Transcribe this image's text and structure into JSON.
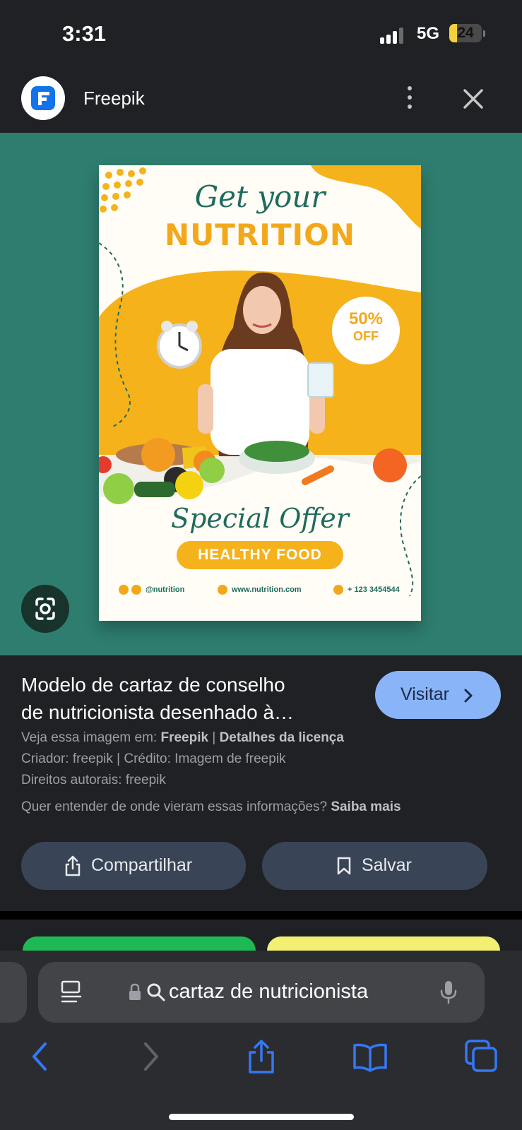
{
  "status_bar": {
    "time": "3:31",
    "network": "5G",
    "battery": "24",
    "battery_level": 0.24
  },
  "site": {
    "name": "Freepik"
  },
  "poster": {
    "title_line1": "Get your",
    "title_line2": "NUTRITION",
    "discount_pct": "50%",
    "discount_off": "OFF",
    "special": "Special Offer",
    "pill": "HEALTHY FOOD",
    "footer_handle": "@nutrition",
    "footer_site": "www.nutrition.com",
    "footer_phone": "+ 123 3454544"
  },
  "result": {
    "title_line1": "Modelo de cartaz de conselho",
    "title_line2": "de nutricionista desenhado à…",
    "visit_label": "Visitar",
    "view_prefix": "Veja essa imagem em:",
    "view_source": "Freepik",
    "separator": "|",
    "license_link": "Detalhes da licença",
    "creator": "Criador: freepik | Crédito: Imagem de freepik",
    "copyright": "Direitos autorais: freepik",
    "question": "Quer entender de onde vieram essas informações?",
    "learn_more": "Saiba mais",
    "share_label": "Compartilhar",
    "save_label": "Salvar"
  },
  "browser": {
    "url_text": "cartaz de nutricionista"
  },
  "colors": {
    "background": "#202124",
    "hero": "#2e7d6e",
    "accent_blue": "#8ab4f8",
    "ios_blue": "#3478f6",
    "button_bg": "#394457",
    "poster_orange": "#f3a81c",
    "poster_green": "#1f6b5c"
  },
  "icons": [
    "freepik-logo-icon",
    "more-vert-icon",
    "close-icon",
    "lens-icon",
    "chevron-right-icon",
    "share-icon",
    "bookmark-icon",
    "reader-icon",
    "lock-icon",
    "search-icon",
    "mic-icon",
    "back-icon",
    "forward-icon",
    "safari-share-icon",
    "bookmarks-icon",
    "tabs-icon"
  ]
}
